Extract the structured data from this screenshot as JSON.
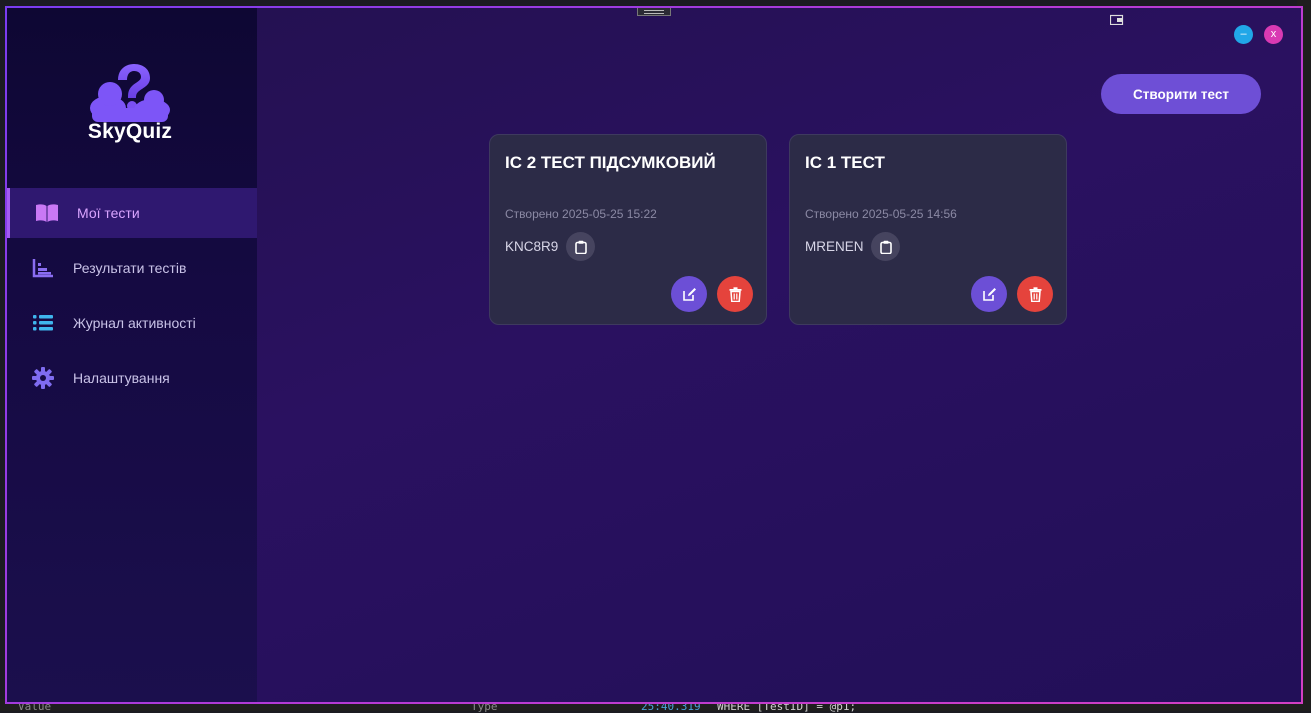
{
  "app": {
    "name": "SkyQuiz"
  },
  "window_controls": {
    "minimize": "–",
    "close": "x"
  },
  "sidebar": {
    "items": [
      {
        "label": "Мої тести",
        "icon": "book-icon",
        "active": true
      },
      {
        "label": "Результати тестів",
        "icon": "chart-icon",
        "active": false
      },
      {
        "label": "Журнал активності",
        "icon": "list-icon",
        "active": false
      },
      {
        "label": "Налаштування",
        "icon": "gear-icon",
        "active": false
      }
    ]
  },
  "toolbar": {
    "create_label": "Створити тест"
  },
  "tests": [
    {
      "title": "ІС 2 ТЕСТ ПІДСУМКОВИЙ",
      "created": "Створено 2025-05-25 15:22",
      "code": "KNC8R9"
    },
    {
      "title": "ІС 1 ТЕСТ",
      "created": "Створено 2025-05-25 14:56",
      "code": "MRENEN"
    }
  ],
  "colors": {
    "accent": "#6e4fd6",
    "danger": "#e5433c",
    "active_nav": "#d9a4ff",
    "min_button": "#21a7e8",
    "close_button": "#d93ab3"
  },
  "background": {
    "bottom_bar": [
      "Value",
      "Type",
      "25:40.319",
      "WHERE [TestID] = @p1;"
    ]
  }
}
